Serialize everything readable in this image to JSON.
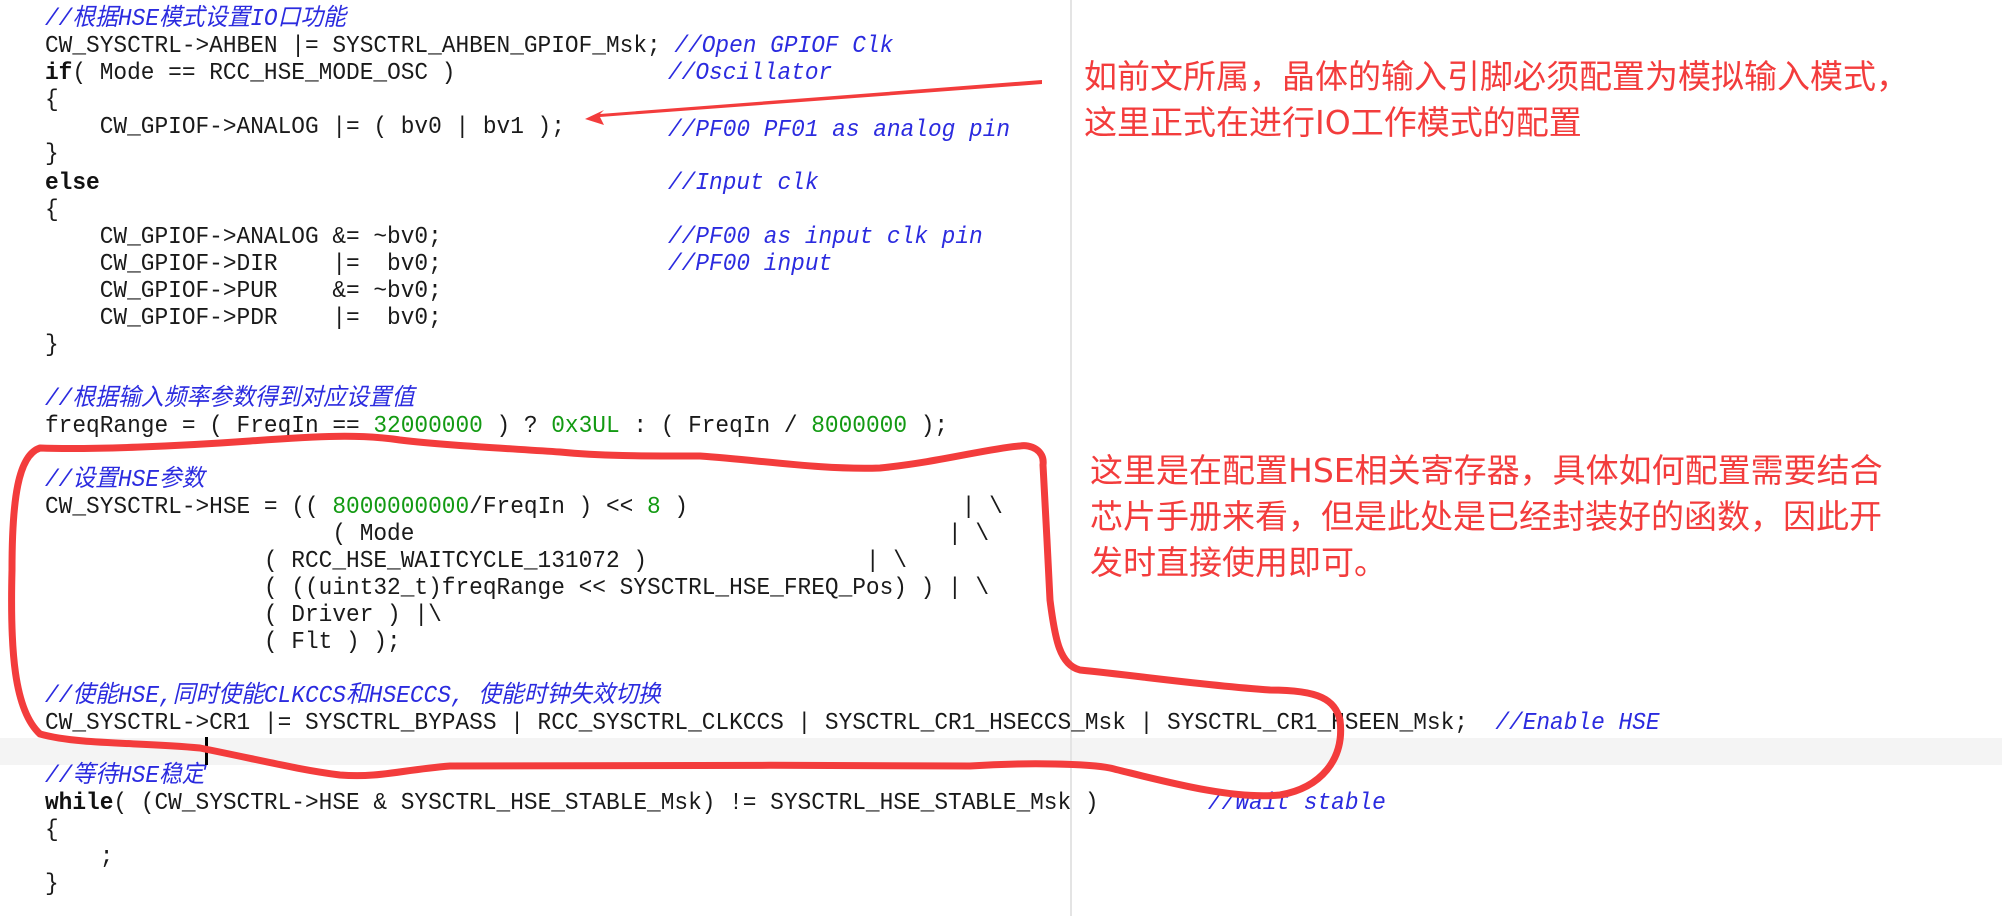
{
  "editor": {
    "lines": [
      {
        "code": "",
        "comment": "//根据HSE模式设置IO口功能"
      },
      {
        "code": "CW_SYSCTRL->AHBEN |= SYSCTRL_AHBEN_GPIOF_Msk; ",
        "comment": "//Open GPIOF Clk"
      },
      {
        "kw": "if",
        "code": "( Mode == RCC_HSE_MODE_OSC )",
        "comment": "//Oscillator"
      },
      {
        "code": "{"
      },
      {
        "code": "    CW_GPIOF->ANALOG |= ( bv0 | bv1 );",
        "comment": "//PF00 PF01 as analog pin"
      },
      {
        "code": "}"
      },
      {
        "kw": "else",
        "code": "",
        "comment": "//Input clk"
      },
      {
        "code": "{"
      },
      {
        "code": "    CW_GPIOF->ANALOG &= ~bv0;",
        "comment": "//PF00 as input clk pin"
      },
      {
        "code": "    CW_GPIOF->DIR    |=  bv0;",
        "comment": "//PF00 input"
      },
      {
        "code": "    CW_GPIOF->PUR    &= ~bv0;"
      },
      {
        "code": "    CW_GPIOF->PDR    |=  bv0;"
      },
      {
        "code": "}"
      },
      {
        "code": ""
      },
      {
        "code": "",
        "comment": "//根据输入频率参数得到对应设置值"
      },
      {
        "code": "freqRange = ( FreqIn == ",
        "num1": "32000000",
        "code2": " ) ? ",
        "num2": "0x3UL",
        "code3": " : ( FreqIn / ",
        "num3": "8000000",
        "code4": " );"
      },
      {
        "code": ""
      },
      {
        "code": "",
        "comment": "//设置HSE参数"
      },
      {
        "code": "CW_SYSCTRL->HSE = (( ",
        "num1": "8000000000",
        "code2": "/FreqIn ) << ",
        "num2": "8",
        "code3": " )                    | \\"
      },
      {
        "code": "                     ( Mode                                       | \\"
      },
      {
        "code": "                ( RCC_HSE_WAITCYCLE_131072 )                | \\"
      },
      {
        "code": "                ( ((uint32_t)freqRange << SYSCTRL_HSE_FREQ_Pos) ) | \\"
      },
      {
        "code": "                ( Driver ) |\\"
      },
      {
        "code": "                ( Flt ) );"
      },
      {
        "code": ""
      },
      {
        "code": "",
        "comment": "//使能HSE,同时使能CLKCCS和HSECCS, 使能时钟失效切换"
      },
      {
        "code": "CW_SYSCTRL->CR1 |= SYSCTRL_BYPASS | RCC_SYSCTRL_CLKCCS | SYSCTRL_CR1_HSECCS_Msk | SYSCTRL_CR1_HSEEN_Msk;  ",
        "comment": "//Enable HSE"
      },
      {
        "code": ""
      },
      {
        "code": "",
        "comment": "//等待HSE稳定"
      },
      {
        "kw": "while",
        "code": "( (CW_SYSCTRL->HSE & SYSCTRL_HSE_STABLE_Msk) != SYSCTRL_HSE_STABLE_Msk )        ",
        "comment": "//Wait stable"
      },
      {
        "code": "{"
      },
      {
        "code": "    ;"
      },
      {
        "code": "}"
      }
    ]
  },
  "annotations": {
    "note1": "如前文所属，晶体的输入引脚必须配置为模拟输入模式，\n这里正式在进行IO工作模式的配置",
    "note2": "这里是在配置HSE相关寄存器，具体如何配置需要结合\n芯片手册来看，但是此处是已经封装好的函数，因此开\n发时直接使用即可。",
    "color": "#f33c3c"
  },
  "colors": {
    "comment": "#2b2bdf",
    "number": "#139a13",
    "code": "#1a1a1a"
  }
}
